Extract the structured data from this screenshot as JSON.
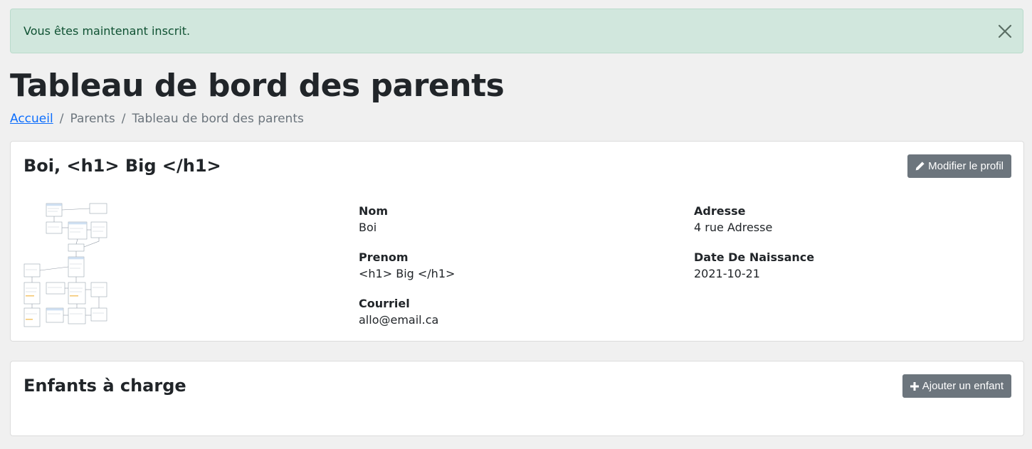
{
  "alert": {
    "message": "Vous êtes maintenant inscrit.",
    "close_icon": "close-icon"
  },
  "page": {
    "title": "Tableau de bord des parents"
  },
  "breadcrumb": {
    "items": [
      "Accueil",
      "Parents",
      "Tableau de bord des parents"
    ],
    "separator": "/"
  },
  "profile": {
    "heading": "Boi, <h1> Big </h1>",
    "edit_button": "Modifier le profil",
    "edit_icon": "pencil-icon",
    "fields": {
      "nom": {
        "label": "Nom",
        "value": "Boi"
      },
      "prenom": {
        "label": "Prenom",
        "value": "<h1> Big </h1>"
      },
      "courriel": {
        "label": "Courriel",
        "value": "allo@email.ca"
      },
      "adresse": {
        "label": "Adresse",
        "value": "4 rue Adresse"
      },
      "naissance": {
        "label": "Date De Naissance",
        "value": "2021-10-21"
      }
    }
  },
  "children": {
    "heading": "Enfants à charge",
    "add_button": "Ajouter un enfant",
    "add_icon": "plus-icon"
  },
  "colors": {
    "alert_bg": "#d1e7dd",
    "alert_text": "#0f5132",
    "link": "#0d6efd",
    "button_bg": "#6c757d",
    "page_bg": "#f0f0f0"
  }
}
